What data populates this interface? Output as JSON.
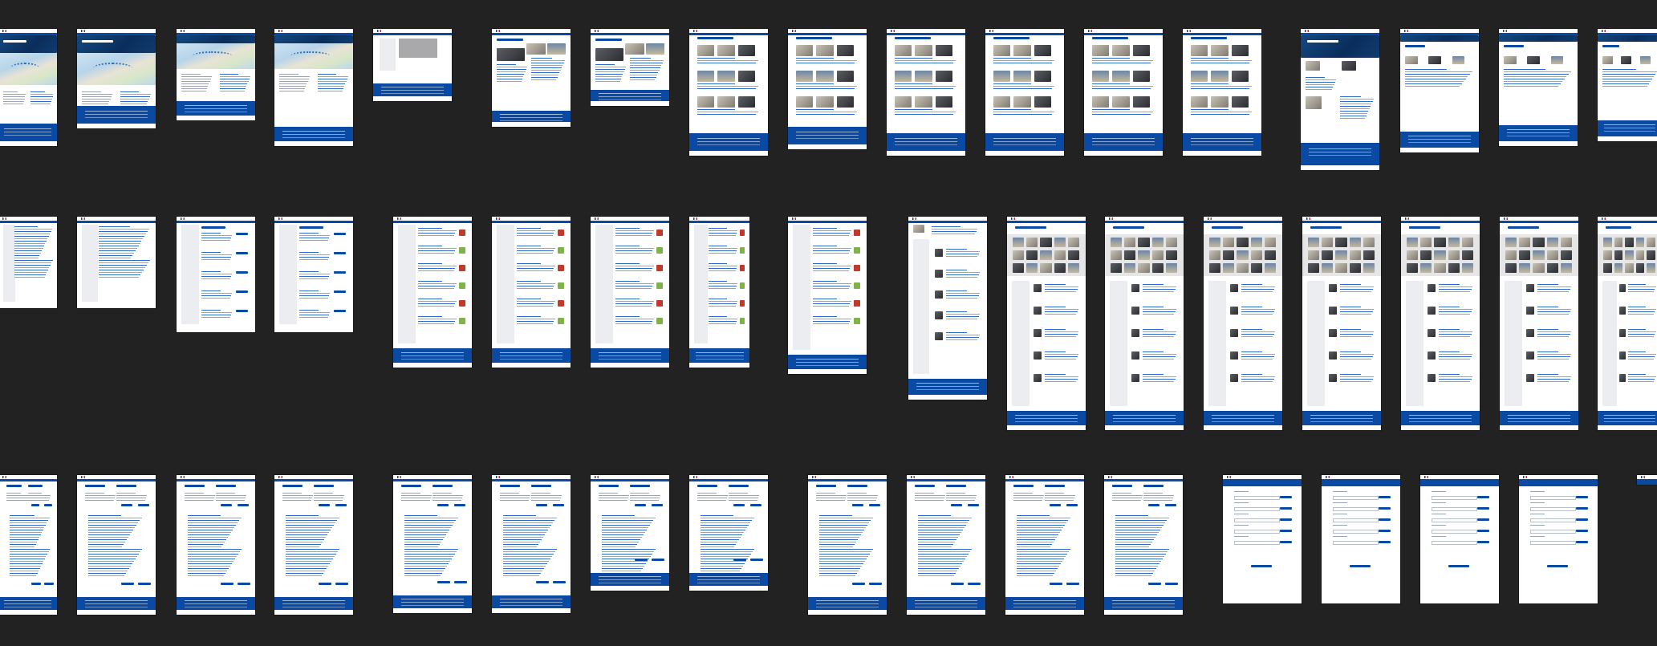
{
  "window": {
    "title": ""
  },
  "colors": {
    "canvas_bg": "#222222",
    "page_bg": "#ffffff",
    "brand_blue": "#0b4aa2",
    "banner_navy": "#0e3b7a",
    "text_grey": "#9aa3b3"
  },
  "overview": {
    "description_visible_text": "",
    "rows": [
      {
        "row": 1,
        "screens": [
          "map-home",
          "map-home",
          "map-page",
          "map-page",
          "grey-panel",
          "photo-article",
          "photo-article",
          "photo-grid",
          "photo-grid",
          "photo-grid",
          "photo-grid",
          "photo-grid",
          "photo-grid",
          "navy-landing",
          "list-page",
          "list-page",
          "list-page"
        ]
      },
      {
        "row": 2,
        "screens": [
          "text-page",
          "text-page",
          "sidebar-form",
          "sidebar-form",
          "sidebar-list",
          "sidebar-list",
          "sidebar-list",
          "sidebar-list",
          "sidebar-list",
          "profile-list",
          "gallery-page",
          "gallery-page",
          "gallery-page",
          "gallery-page",
          "gallery-page",
          "gallery-page",
          "gallery-page"
        ]
      },
      {
        "row": 3,
        "screens": [
          "tree-page",
          "tree-page",
          "tree-page",
          "tree-page",
          "tree-page",
          "tree-page",
          "tree-page",
          "tree-page",
          "tree-page",
          "tree-page",
          "tree-page",
          "tree-page",
          "form-page",
          "form-page",
          "form-page",
          "form-page",
          "form-page"
        ]
      }
    ]
  }
}
